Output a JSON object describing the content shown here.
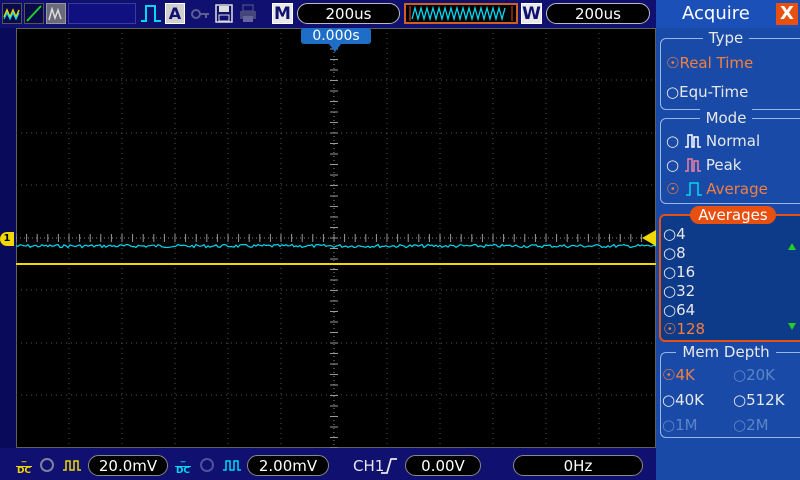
{
  "toolbar": {
    "menu_key": "M",
    "timebase_main": "200us",
    "window_key": "W",
    "timebase_window": "200us",
    "run_mode_icon": "A"
  },
  "scope": {
    "trigger_position": "0.000s"
  },
  "status": {
    "ch1_scale": "20.0mV",
    "ch2_scale": "2.00mV",
    "trigger_source": "CH1",
    "trigger_level": "0.00V",
    "frequency": "0Hz",
    "ch1_coupling": "DC",
    "ch2_coupling": "DC"
  },
  "menu": {
    "title": "Acquire",
    "close_glyph": "X",
    "type_section": "Type",
    "type_options": [
      "Real Time",
      "Equ-Time"
    ],
    "mode_section": "Mode",
    "mode_options": [
      "Normal",
      "Peak",
      "Average"
    ],
    "averages_section": "Averages",
    "averages_options": [
      "4",
      "8",
      "16",
      "32",
      "64",
      "128"
    ],
    "mem_section": "Mem Depth",
    "mem_options": [
      "4K",
      "20K",
      "40K",
      "512K",
      "1M",
      "2M"
    ]
  },
  "colors": {
    "ch1": "#f0d800",
    "ch2": "#00d8f0",
    "accent": "#e85010",
    "menu_bg": "#1a4aa8"
  }
}
